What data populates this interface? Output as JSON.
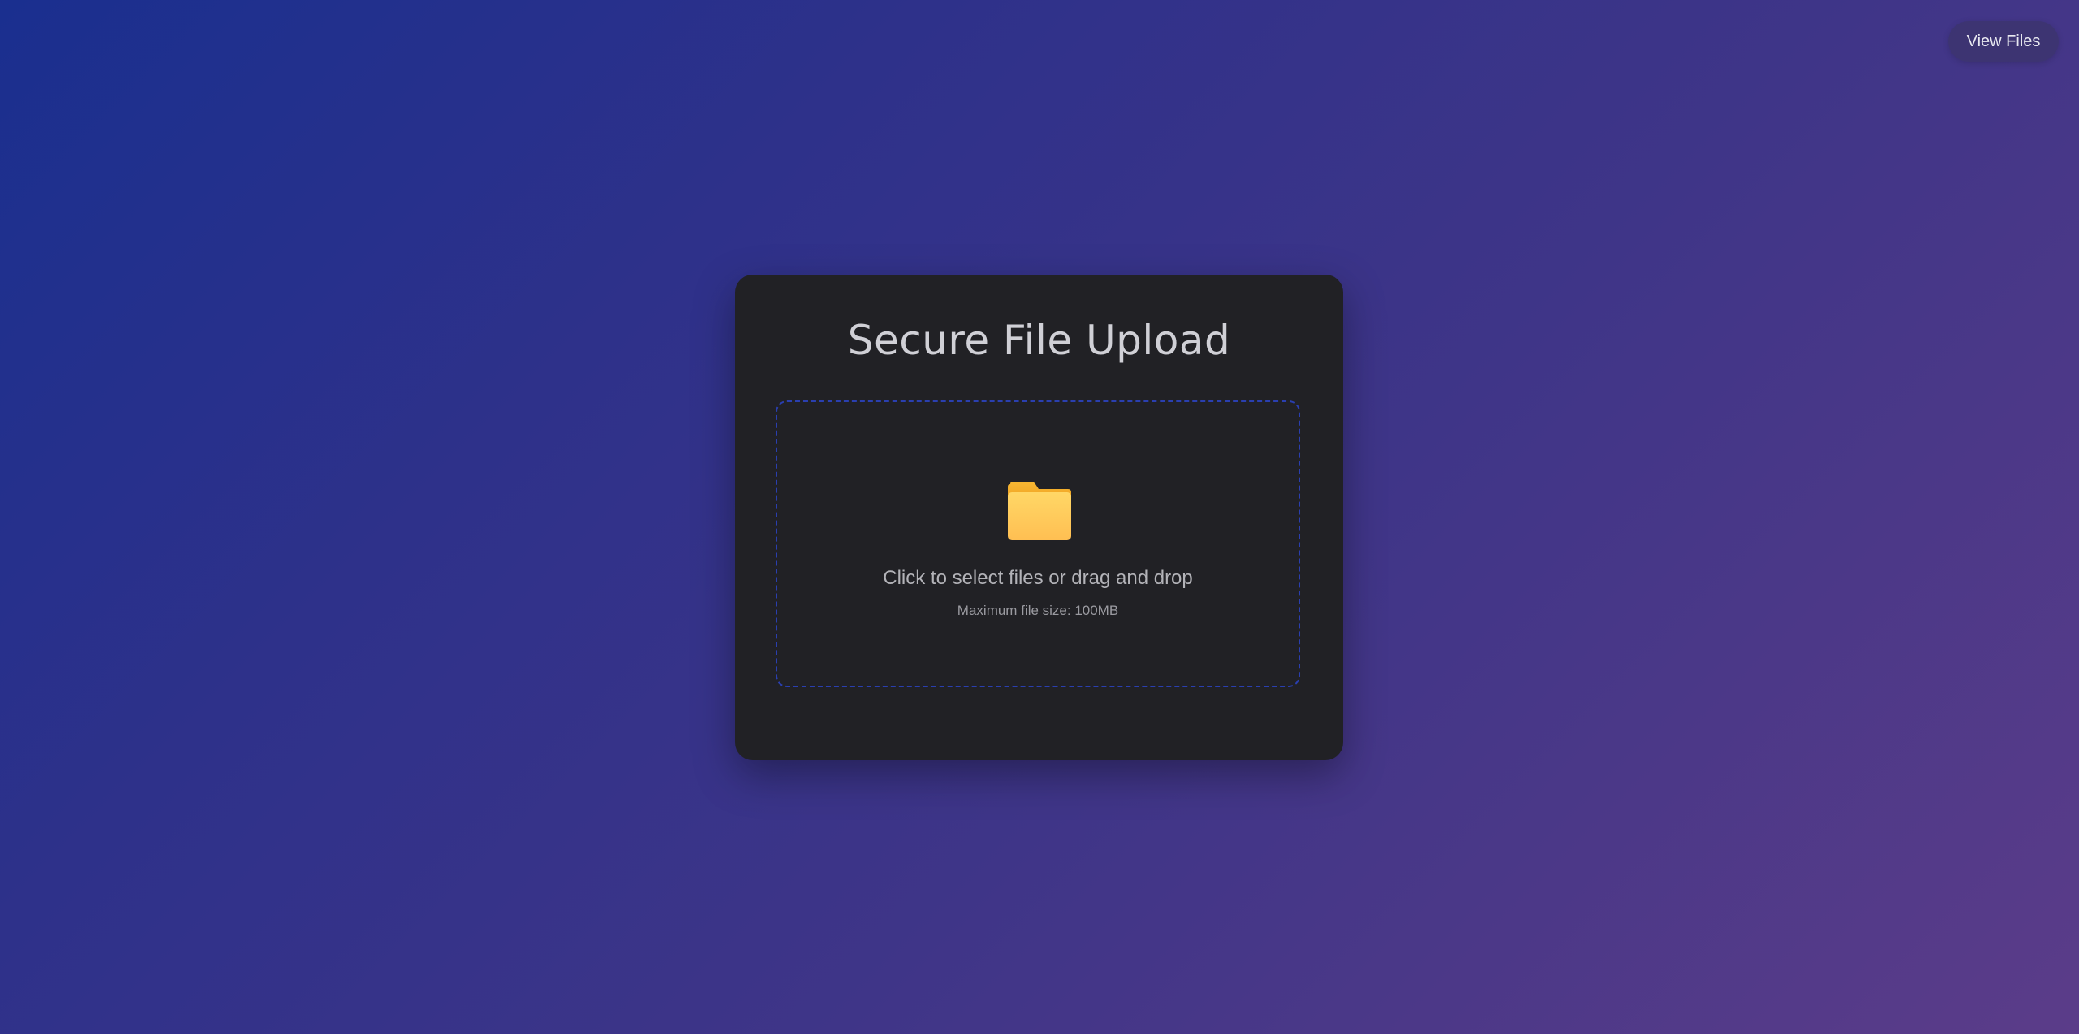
{
  "header": {
    "view_files_label": "View Files"
  },
  "upload_card": {
    "title": "Secure File Upload",
    "dropzone": {
      "icon": "folder-icon",
      "prompt": "Click to select files or drag and drop",
      "max_size_note": "Maximum file size: 100MB"
    }
  },
  "colors": {
    "background_start": "#1a2f8f",
    "background_end": "#5b3c89",
    "card_bg": "#212125",
    "dropzone_border": "#2a3fb0",
    "folder_icon": "#ffc34d"
  }
}
